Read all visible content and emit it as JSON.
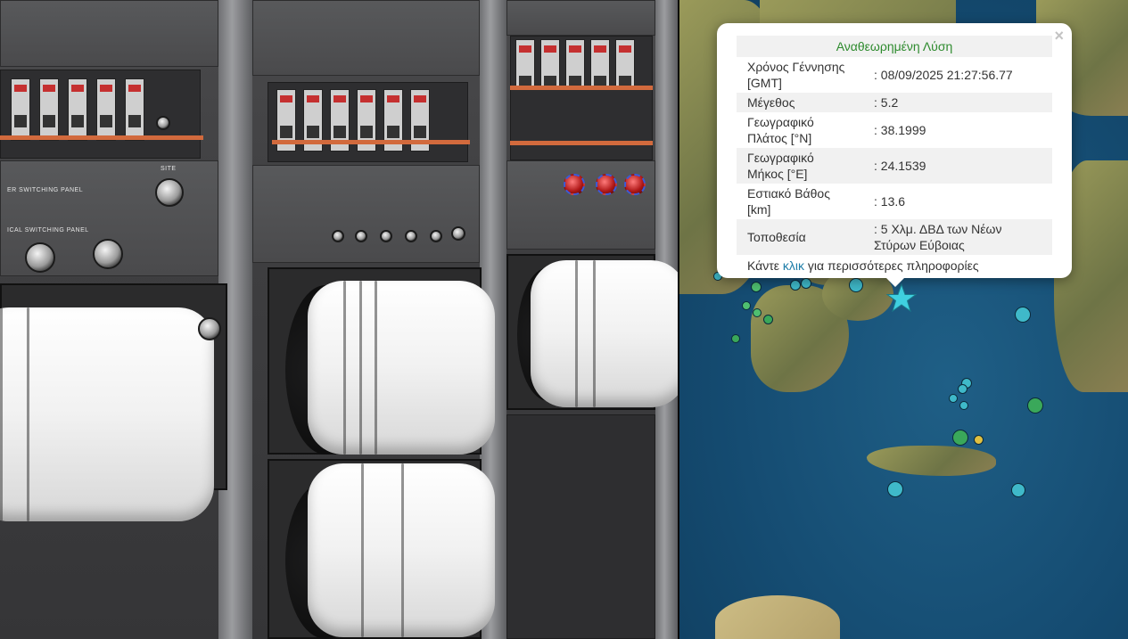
{
  "popup": {
    "close_symbol": "×",
    "title": "Αναθεωρημένη Λύση",
    "rows": [
      {
        "label": "Χρόνος Γέννησης [GMT]",
        "value": ": 08/09/2025 21:27:56.77"
      },
      {
        "label": "Μέγεθος",
        "value": ": 5.2"
      },
      {
        "label": "Γεωγραφικό Πλάτος [°N]",
        "value": ": 38.1999"
      },
      {
        "label": "Γεωγραφικό Μήκος [°E]",
        "value": ": 24.1539"
      },
      {
        "label": "Εστιακό Βάθος [km]",
        "value": ": 13.6"
      },
      {
        "label": "Τοποθεσία",
        "value": ": 5 Χλμ. ΔΒΔ των Νέων Στύρων Εύβοιας"
      }
    ],
    "link_prefix": "Κάντε ",
    "link_text": "κλικ",
    "link_suffix": " για περισσότερες πληροφορίες"
  },
  "photo": {
    "panel_label_1": "ER SWITCHING PANEL",
    "panel_label_2": "ICAL SWITCHING PANEL",
    "knob_label": "SITE"
  },
  "colors": {
    "popup_title": "#2e8b2e",
    "link": "#1d7da8",
    "epicenter_star": "#3fd0e0",
    "sea": "#154c72"
  },
  "icons": {
    "close": "close-icon",
    "epicenter": "star-icon"
  }
}
